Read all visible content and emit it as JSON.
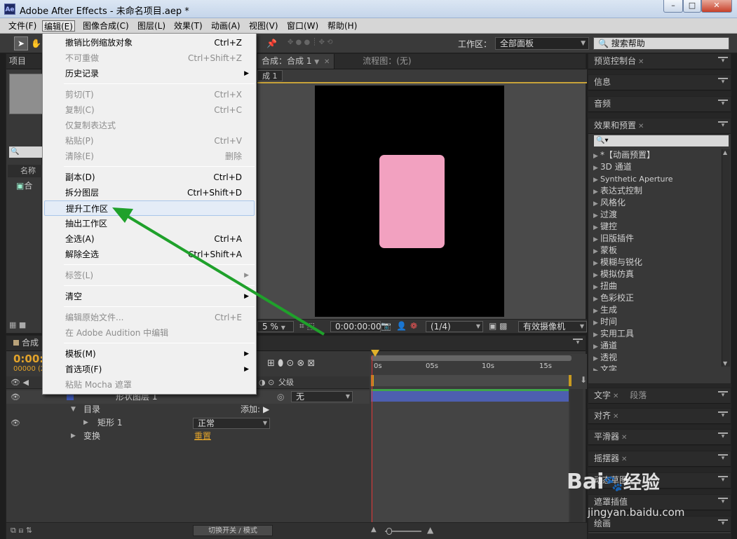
{
  "window": {
    "title": "Adobe After Effects - 未命名项目.aep *",
    "logo": "Ae",
    "min": "–",
    "max": "□",
    "close": "✕"
  },
  "menubar": [
    "文件(F)",
    "编辑(E)",
    "图像合成(C)",
    "图层(L)",
    "效果(T)",
    "动画(A)",
    "视图(V)",
    "窗口(W)",
    "帮助(H)"
  ],
  "toolbar": {
    "workspace_label": "工作区：",
    "workspace_value": "全部面板",
    "search_placeholder": "搜索帮助"
  },
  "project_panel": {
    "tab": "项目",
    "search_icon": "🔍",
    "column_name": "名称",
    "item": "合"
  },
  "comp_panel": {
    "tab": "合成：合成 1",
    "flow_tab": "流程图：(无)",
    "crumb": "成 1",
    "zoom": "5 %",
    "timecode": "0:00:00:00",
    "resolution": "(1/4)",
    "camera": "有效摄像机",
    "shape_color": "#f2a1c0"
  },
  "edit_menu": {
    "items": [
      {
        "label": "撤销比例缩放对象",
        "shortcut": "Ctrl+Z",
        "disabled": false
      },
      {
        "label": "不可重做",
        "shortcut": "Ctrl+Shift+Z",
        "disabled": true
      },
      {
        "label": "历史记录",
        "shortcut": "",
        "disabled": false,
        "submenu": true
      },
      {
        "label": "剪切(T)",
        "shortcut": "Ctrl+X",
        "disabled": true
      },
      {
        "label": "复制(C)",
        "shortcut": "Ctrl+C",
        "disabled": true
      },
      {
        "label": "仅复制表达式",
        "shortcut": "",
        "disabled": true
      },
      {
        "label": "粘贴(P)",
        "shortcut": "Ctrl+V",
        "disabled": true
      },
      {
        "label": "清除(E)",
        "shortcut": "删除",
        "disabled": true
      },
      {
        "label": "副本(D)",
        "shortcut": "Ctrl+D",
        "disabled": false
      },
      {
        "label": "拆分图层",
        "shortcut": "Ctrl+Shift+D",
        "disabled": false
      },
      {
        "label": "提升工作区",
        "shortcut": "",
        "disabled": false,
        "highlighted": true
      },
      {
        "label": "抽出工作区",
        "shortcut": "",
        "disabled": false
      },
      {
        "label": "全选(A)",
        "shortcut": "Ctrl+A",
        "disabled": false
      },
      {
        "label": "解除全选",
        "shortcut": "Ctrl+Shift+A",
        "disabled": false
      },
      {
        "label": "标签(L)",
        "shortcut": "",
        "disabled": true,
        "submenu": true
      },
      {
        "label": "清空",
        "shortcut": "",
        "disabled": false,
        "submenu": true
      },
      {
        "label": "编辑原始文件...",
        "shortcut": "Ctrl+E",
        "disabled": true
      },
      {
        "label": "在 Adobe Audition 中编辑",
        "shortcut": "",
        "disabled": true
      },
      {
        "label": "模板(M)",
        "shortcut": "",
        "disabled": false,
        "submenu": true
      },
      {
        "label": "首选项(F)",
        "shortcut": "",
        "disabled": false,
        "submenu": true
      },
      {
        "label": "粘贴 Mocha 遮罩",
        "shortcut": "",
        "disabled": true
      }
    ]
  },
  "right_panels": {
    "preview": "预览控制台",
    "info": "信息",
    "audio": "音频",
    "effects": "效果和预置",
    "effects_list": [
      "*【动画预置】",
      "3D 通道",
      "Synthetic Aperture",
      "表达式控制",
      "风格化",
      "过渡",
      "键控",
      "旧版插件",
      "蒙板",
      "模糊与锐化",
      "模拟仿真",
      "扭曲",
      "色彩校正",
      "生成",
      "时间",
      "实用工具",
      "通道",
      "透视",
      "文字"
    ],
    "text": "文字",
    "paragraph": "段落",
    "align": "对齐",
    "smoother": "平滑器",
    "wiggler": "摇摆器",
    "motion_sketch": "动态草图",
    "mask_interp": "遮罩插值",
    "paint": "绘画"
  },
  "timeline": {
    "tab": "合成",
    "timecode": "0:00:",
    "frames": "00000 (2",
    "parent_label": "父级",
    "layer_name": "形状图层 1",
    "parent_value": "无",
    "contents": "目录",
    "add_label": "添加:",
    "rect": "矩形 1",
    "blend_mode": "正常",
    "transform": "变换",
    "reset": "重置",
    "ruler": [
      "0s",
      "05s",
      "10s",
      "15s"
    ],
    "toggle_label": "切换开关 / 模式"
  },
  "watermark": {
    "brand": "Bai",
    "brand2": "经验",
    "url": "jingyan.baidu.com"
  }
}
